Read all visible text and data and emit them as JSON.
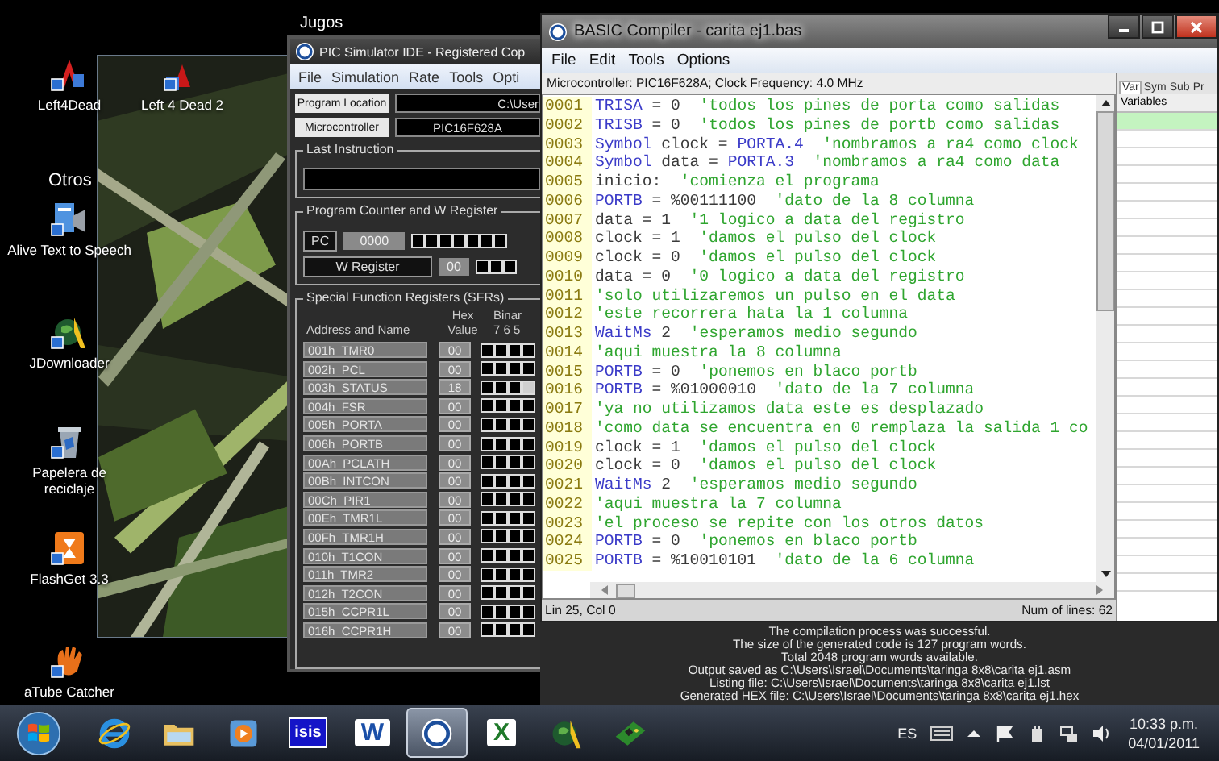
{
  "desktop": {
    "top_label": "Jugos",
    "section_label": "Otros",
    "icons": [
      {
        "label": "Left4Dead",
        "kind": "game"
      },
      {
        "label": "Left 4 Dead 2",
        "kind": "game2"
      },
      {
        "label": "Alive Text to Speech",
        "kind": "speech"
      },
      {
        "label": "JDownloader",
        "kind": "downloader"
      },
      {
        "label": "Papelera de reciclaje",
        "kind": "bin"
      },
      {
        "label": "FlashGet 3.3",
        "kind": "flashget"
      },
      {
        "label": "aTube Catcher",
        "kind": "hand"
      }
    ]
  },
  "pic_simulator": {
    "title": "PIC Simulator IDE - Registered Cop",
    "menu": [
      "File",
      "Simulation",
      "Rate",
      "Tools",
      "Opti"
    ],
    "program_location": {
      "label": "Program Location",
      "value": "C:\\User"
    },
    "microcontroller": {
      "label": "Microcontroller",
      "value": "PIC16F628A"
    },
    "last_instruction": {
      "title": "Last Instruction"
    },
    "pc_group": {
      "title": "Program Counter and W Register",
      "pc_label": "PC",
      "pc_value": "0000",
      "w_label": "W Register",
      "w_value": "00"
    },
    "sfr": {
      "title": "Special Function Registers (SFRs)",
      "col_name": "Address and Name",
      "col_hex_1": "Hex",
      "col_hex_2": "Value",
      "col_bin": "Binar",
      "bit_labels": "7 6 5",
      "registers": [
        {
          "name": "001h  TMR0",
          "value": "00"
        },
        {
          "name": "002h  PCL",
          "value": "00"
        },
        {
          "name": "003h  STATUS",
          "value": "18"
        },
        {
          "name": "004h  FSR",
          "value": "00"
        },
        {
          "name": "005h  PORTA",
          "value": "00"
        },
        {
          "name": "006h  PORTB",
          "value": "00"
        },
        {
          "name": "00Ah  PCLATH",
          "value": "00"
        },
        {
          "name": "00Bh  INTCON",
          "value": "00"
        },
        {
          "name": "00Ch  PIR1",
          "value": "00"
        },
        {
          "name": "00Eh  TMR1L",
          "value": "00"
        },
        {
          "name": "00Fh  TMR1H",
          "value": "00"
        },
        {
          "name": "010h  T1CON",
          "value": "00"
        },
        {
          "name": "011h  TMR2",
          "value": "00"
        },
        {
          "name": "012h  T2CON",
          "value": "00"
        },
        {
          "name": "015h  CCPR1L",
          "value": "00"
        },
        {
          "name": "016h  CCPR1H",
          "value": "00"
        }
      ]
    }
  },
  "compiler": {
    "title": "BASIC Compiler - carita ej1.bas",
    "menu": [
      "File",
      "Edit",
      "Tools",
      "Options"
    ],
    "info": "Microcontroller: PIC16F628A;  Clock Frequency: 4.0 MHz",
    "lines": [
      {
        "number": "0001",
        "tokens": [
          {
            "kind": "keyword",
            "text": "TRISA"
          },
          {
            "kind": "plain",
            "text": " = 0  "
          },
          {
            "kind": "comment",
            "text": "'todos los pines de porta como salidas"
          }
        ]
      },
      {
        "number": "0002",
        "tokens": [
          {
            "kind": "keyword",
            "text": "TRISB"
          },
          {
            "kind": "plain",
            "text": " = 0  "
          },
          {
            "kind": "comment",
            "text": "'todos los pines de portb como salidas"
          }
        ]
      },
      {
        "number": "0003",
        "tokens": [
          {
            "kind": "keyword",
            "text": "Symbol"
          },
          {
            "kind": "plain",
            "text": " clock = "
          },
          {
            "kind": "keyword",
            "text": "PORTA.4  "
          },
          {
            "kind": "comment",
            "text": "'nombramos a ra4 como clock"
          }
        ]
      },
      {
        "number": "0004",
        "tokens": [
          {
            "kind": "keyword",
            "text": "Symbol"
          },
          {
            "kind": "plain",
            "text": " data = "
          },
          {
            "kind": "keyword",
            "text": "PORTA.3  "
          },
          {
            "kind": "comment",
            "text": "'nombramos a ra4 como data"
          }
        ]
      },
      {
        "number": "0005",
        "tokens": [
          {
            "kind": "plain",
            "text": "inicio:  "
          },
          {
            "kind": "comment",
            "text": "'comienza el programa"
          }
        ]
      },
      {
        "number": "0006",
        "tokens": [
          {
            "kind": "keyword",
            "text": "PORTB"
          },
          {
            "kind": "plain",
            "text": " = %00111100  "
          },
          {
            "kind": "comment",
            "text": "'dato de la 8 columna"
          }
        ]
      },
      {
        "number": "0007",
        "tokens": [
          {
            "kind": "plain",
            "text": "data = 1  "
          },
          {
            "kind": "comment",
            "text": "'1 logico a data del registro"
          }
        ]
      },
      {
        "number": "0008",
        "tokens": [
          {
            "kind": "plain",
            "text": "clock = 1  "
          },
          {
            "kind": "comment",
            "text": "'damos el pulso del clock"
          }
        ]
      },
      {
        "number": "0009",
        "tokens": [
          {
            "kind": "plain",
            "text": "clock = 0  "
          },
          {
            "kind": "comment",
            "text": "'damos el pulso del clock"
          }
        ]
      },
      {
        "number": "0010",
        "tokens": [
          {
            "kind": "plain",
            "text": "data = 0  "
          },
          {
            "kind": "comment",
            "text": "'0 logico a data del registro"
          }
        ]
      },
      {
        "number": "0011",
        "tokens": [
          {
            "kind": "comment",
            "text": "'solo utilizaremos un pulso en el data"
          }
        ]
      },
      {
        "number": "0012",
        "tokens": [
          {
            "kind": "comment",
            "text": "'este recorrera hata la 1 columna"
          }
        ]
      },
      {
        "number": "0013",
        "tokens": [
          {
            "kind": "keyword",
            "text": "WaitMs"
          },
          {
            "kind": "plain",
            "text": " 2  "
          },
          {
            "kind": "comment",
            "text": "'esperamos medio segundo"
          }
        ]
      },
      {
        "number": "0014",
        "tokens": [
          {
            "kind": "comment",
            "text": "'aqui muestra la 8 columna"
          }
        ]
      },
      {
        "number": "0015",
        "tokens": [
          {
            "kind": "keyword",
            "text": "PORTB"
          },
          {
            "kind": "plain",
            "text": " = 0  "
          },
          {
            "kind": "comment",
            "text": "'ponemos en blaco portb"
          }
        ]
      },
      {
        "number": "0016",
        "tokens": [
          {
            "kind": "keyword",
            "text": "PORTB"
          },
          {
            "kind": "plain",
            "text": " = %01000010  "
          },
          {
            "kind": "comment",
            "text": "'dato de la 7 columna"
          }
        ]
      },
      {
        "number": "0017",
        "tokens": [
          {
            "kind": "comment",
            "text": "'ya no utilizamos data este es desplazado"
          }
        ]
      },
      {
        "number": "0018",
        "tokens": [
          {
            "kind": "comment",
            "text": "'como data se encuentra en 0 remplaza la salida 1 co"
          }
        ]
      },
      {
        "number": "0019",
        "tokens": [
          {
            "kind": "plain",
            "text": "clock = 1  "
          },
          {
            "kind": "comment",
            "text": "'damos el pulso del clock"
          }
        ]
      },
      {
        "number": "0020",
        "tokens": [
          {
            "kind": "plain",
            "text": "clock = 0  "
          },
          {
            "kind": "comment",
            "text": "'damos el pulso del clock"
          }
        ]
      },
      {
        "number": "0021",
        "tokens": [
          {
            "kind": "keyword",
            "text": "WaitMs"
          },
          {
            "kind": "plain",
            "text": " 2  "
          },
          {
            "kind": "comment",
            "text": "'esperamos medio segundo"
          }
        ]
      },
      {
        "number": "0022",
        "tokens": [
          {
            "kind": "comment",
            "text": "'aqui muestra la 7 columna"
          }
        ]
      },
      {
        "number": "0023",
        "tokens": [
          {
            "kind": "comment",
            "text": "'el proceso se repite con los otros datos"
          }
        ]
      },
      {
        "number": "0024",
        "tokens": [
          {
            "kind": "keyword",
            "text": "PORTB"
          },
          {
            "kind": "plain",
            "text": " = 0  "
          },
          {
            "kind": "comment",
            "text": "'ponemos en blaco portb"
          }
        ]
      },
      {
        "number": "0025",
        "tokens": [
          {
            "kind": "keyword",
            "text": "PORTB"
          },
          {
            "kind": "plain",
            "text": " = %10010101  "
          },
          {
            "kind": "comment",
            "text": "'dato de la 6 columna"
          }
        ]
      }
    ],
    "status_position": "Lin 25, Col 0",
    "status_lines": "Num of lines: 62",
    "side_tabs": [
      {
        "label": "Var",
        "selected": true
      },
      {
        "label": "Sym",
        "selected": false
      },
      {
        "label": "Sub",
        "selected": false
      },
      {
        "label": "Pr",
        "selected": false
      }
    ],
    "side_header": "Variables",
    "output": [
      "The compilation process was successful.",
      "The size of the generated code is 127 program words.",
      "Total 2048 program words available.",
      "Output saved as C:\\Users\\Israel\\Documents\\taringa 8x8\\carita ej1.asm",
      "Listing file: C:\\Users\\Israel\\Documents\\taringa 8x8\\carita ej1.lst",
      "Generated HEX file: C:\\Users\\Israel\\Documents\\taringa 8x8\\carita ej1.hex"
    ]
  },
  "taskbar": {
    "apps": [
      {
        "kind": "ie",
        "active": false
      },
      {
        "kind": "folder",
        "active": false
      },
      {
        "kind": "media",
        "active": false
      },
      {
        "kind": "isis",
        "label": "isis",
        "active": false
      },
      {
        "kind": "word",
        "label": "W",
        "active": false
      },
      {
        "kind": "simulator",
        "active": true
      },
      {
        "kind": "excel",
        "label": "X",
        "active": false
      },
      {
        "kind": "globe",
        "active": false
      },
      {
        "kind": "board",
        "active": false
      }
    ],
    "language": "ES",
    "time": "10:33 p.m.",
    "date": "04/01/2011"
  }
}
